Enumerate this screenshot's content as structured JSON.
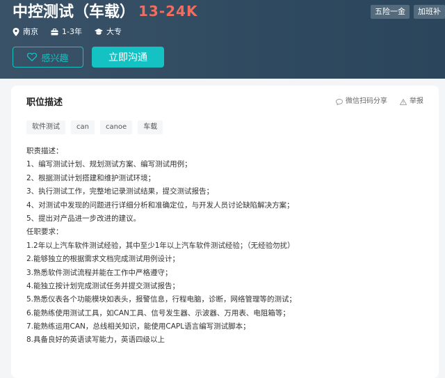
{
  "header": {
    "job_title": "中控测试（车载）",
    "salary": "13-24K",
    "benefits": [
      "五险一金",
      "加班补"
    ],
    "meta": {
      "location": "南京",
      "experience": "1-3年",
      "education": "大专"
    },
    "like_label": "感兴趣",
    "chat_label": "立即沟通"
  },
  "detail": {
    "section_title": "职位描述",
    "share_label": "微信扫码分享",
    "report_label": "举报",
    "skill_tags": [
      "软件测试",
      "can",
      "canoe",
      "车载"
    ],
    "description_lines": [
      "职责描述：",
      "1、编写测试计划、规划测试方案、编写测试用例；",
      "2、根据测试计划搭建和维护测试环境；",
      "3、执行测试工作，完整地记录测试结果，提交测试报告；",
      "4、对测试中发现的问题进行详细分析和准确定位，与开发人员讨论缺陷解决方案；",
      "5、提出对产品进一步改进的建议。",
      "任职要求：",
      "1.2年以上汽车软件测试经验，其中至少1年以上汽车软件测试经验；（无经验勿扰）",
      "2.能够独立的根据需求文档完成测试用例设计；",
      "3.熟悉软件测试流程并能在工作中严格遵守；",
      "4.能独立按计划完成测试任务并提交测试报告；",
      "5.熟悉仪表各个功能模块如表头，报警信息，行程电脑，诊断，网络管理等的测试；",
      "6.能熟练使用测试工具，如CAN工具、信号发生器、示波器、万用表、电阻箱等；",
      "7.能熟练运用CAN，总线相关知识，能使用CAPL语言编写测试脚本；",
      "8.具备良好的英语读写能力，英语四级以上"
    ]
  },
  "colors": {
    "header_bg": "#2f4a60",
    "accent": "#14c2c3",
    "salary": "#f26d5f"
  }
}
